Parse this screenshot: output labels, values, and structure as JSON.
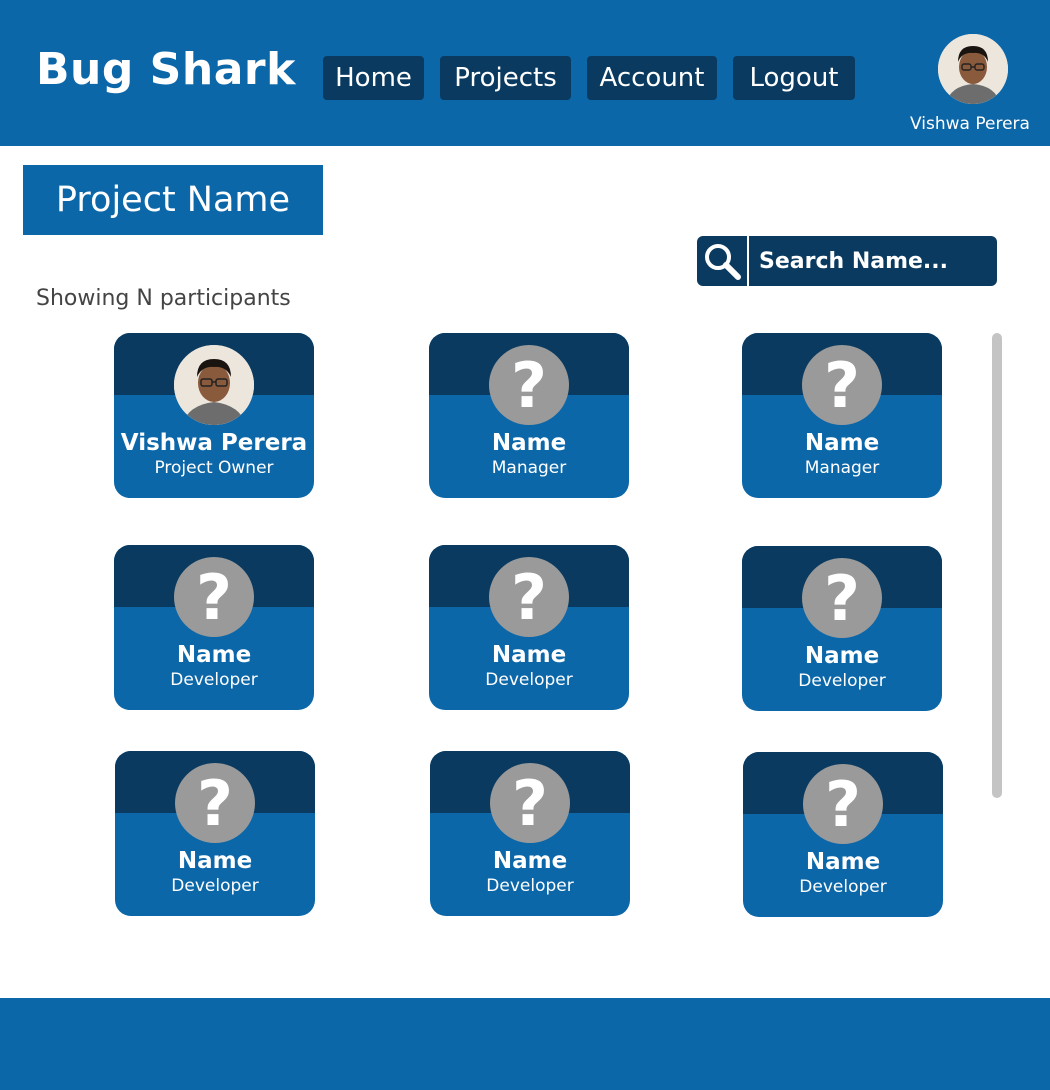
{
  "header": {
    "brand": "Bug Shark",
    "nav": [
      "Home",
      "Projects",
      "Account",
      "Logout"
    ],
    "user_name": "Vishwa Perera",
    "user_icon": "user-avatar-photo"
  },
  "project": {
    "title": "Project Name"
  },
  "search": {
    "placeholder": "Search Name...",
    "icon": "search-icon"
  },
  "participants": {
    "summary": "Showing N participants",
    "cards": [
      {
        "name": "Vishwa Perera",
        "role": "Project Owner",
        "avatar": "photo"
      },
      {
        "name": "Name",
        "role": "Manager",
        "avatar": "?"
      },
      {
        "name": "Name",
        "role": "Manager",
        "avatar": "?"
      },
      {
        "name": "Name",
        "role": "Developer",
        "avatar": "?"
      },
      {
        "name": "Name",
        "role": "Developer",
        "avatar": "?"
      },
      {
        "name": "Name",
        "role": "Developer",
        "avatar": "?"
      },
      {
        "name": "Name",
        "role": "Developer",
        "avatar": "?"
      },
      {
        "name": "Name",
        "role": "Developer",
        "avatar": "?"
      },
      {
        "name": "Name",
        "role": "Developer",
        "avatar": "?"
      }
    ]
  },
  "colors": {
    "primary": "#0c67a9",
    "dark": "#0a3a5f",
    "placeholder_avatar": "#9a9a9a"
  }
}
